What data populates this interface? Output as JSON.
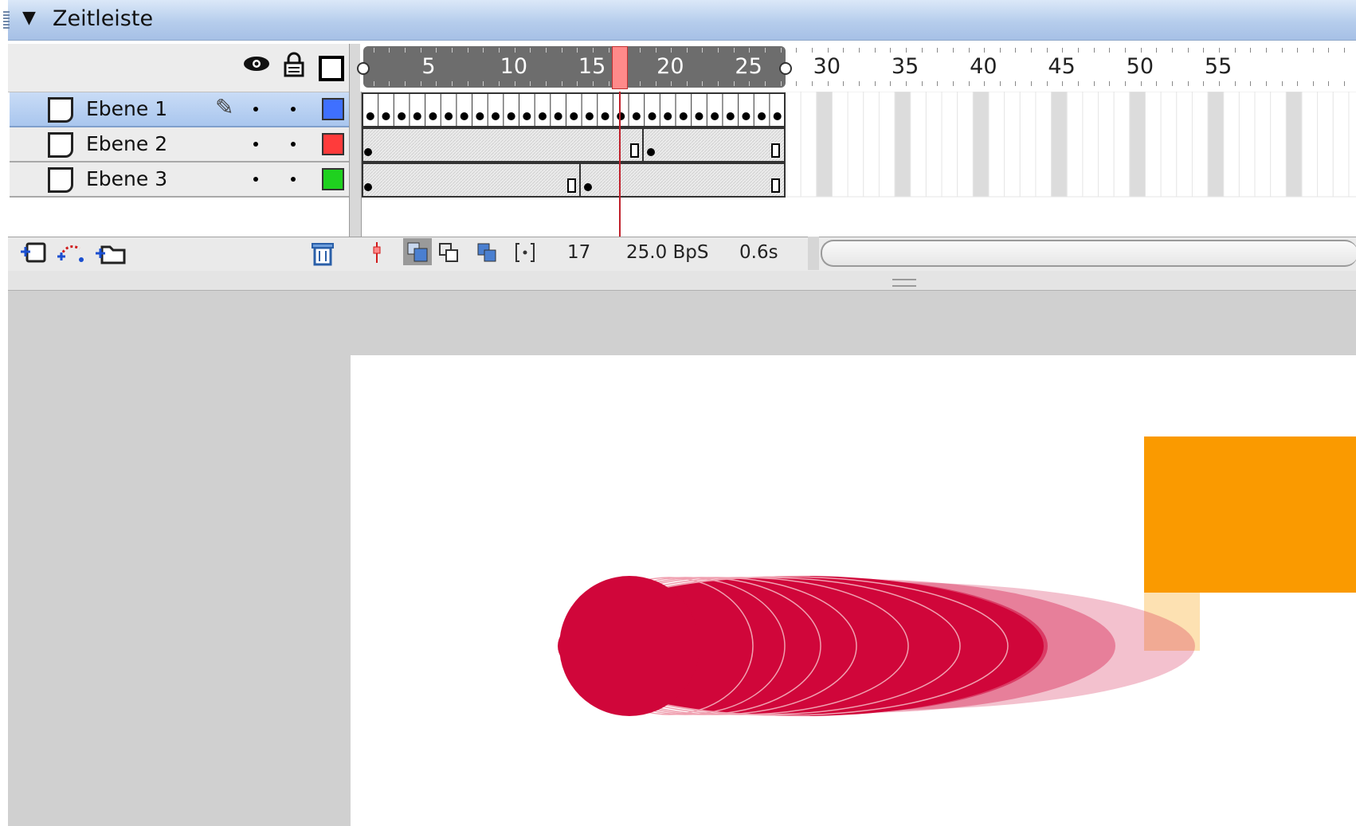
{
  "panel": {
    "title": "Zeitleiste"
  },
  "layers": [
    {
      "name": "Ebene 1",
      "color": "#3f70ff",
      "selected": true
    },
    {
      "name": "Ebene 2",
      "color": "#ff3b3b",
      "selected": false
    },
    {
      "name": "Ebene 3",
      "color": "#1fd11f",
      "selected": false
    }
  ],
  "ruler": {
    "labels": [
      "5",
      "10",
      "15",
      "20",
      "25",
      "30",
      "35",
      "40",
      "45",
      "50",
      "55"
    ]
  },
  "status": {
    "current_frame": "17",
    "frame_rate": "25.0 BpS",
    "elapsed_time": "0.6s"
  },
  "icons": {
    "visibility": "eye-icon",
    "lock": "lock-icon",
    "outline": "outline-square-icon",
    "layer": "layer-page-icon",
    "edit": "pencil-icon",
    "insert_layer": "insert-layer-icon",
    "motion_guide": "motion-guide-icon",
    "layer_folder": "insert-folder-icon",
    "delete": "trash-icon",
    "center_frame": "center-frame-icon",
    "onion_skin": "onion-skin-icon",
    "onion_outline": "onion-skin-outline-icon",
    "edit_multiple": "edit-multiple-frames-icon",
    "onion_markers": "onion-markers-icon"
  },
  "colors": {
    "accent_blue": "#b6cdec",
    "playhead": "#ff8a8a",
    "stage_shape_red": "#d0063a",
    "stage_shape_orange": "#fa9a00"
  }
}
